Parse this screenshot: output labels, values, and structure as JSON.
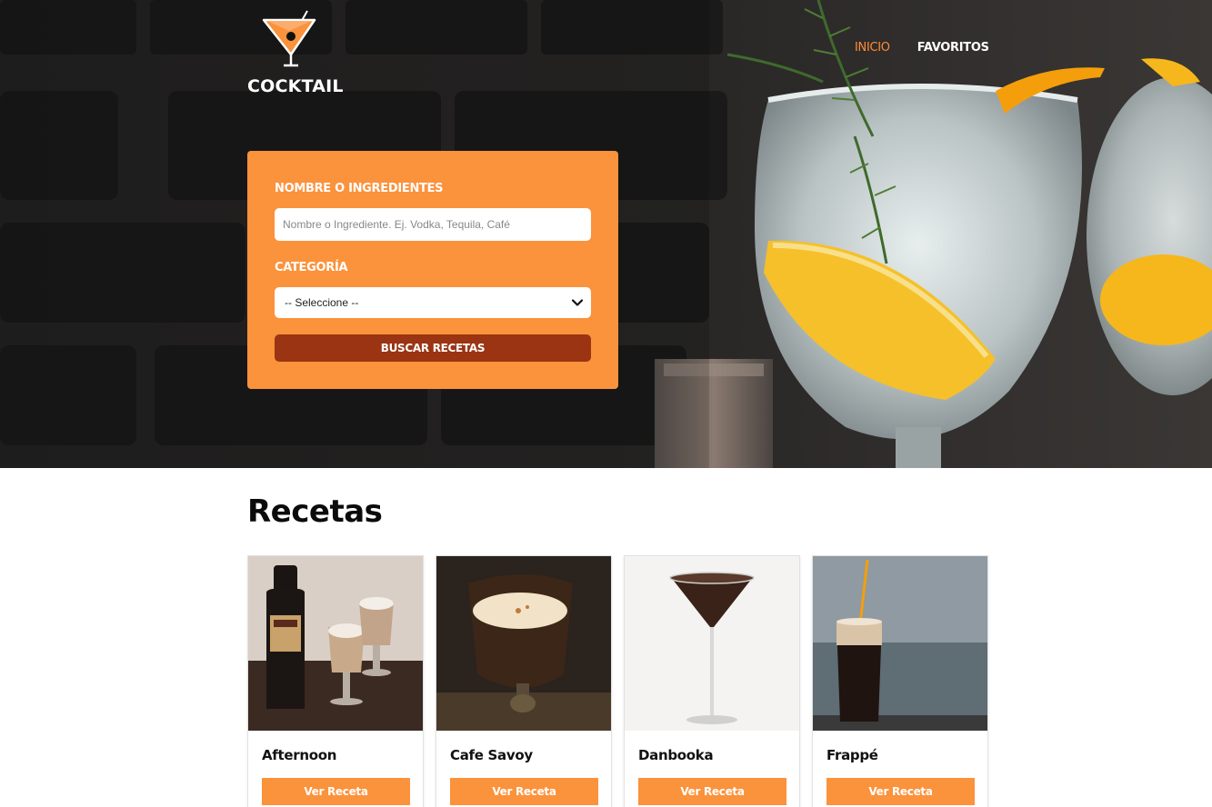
{
  "brand": {
    "name": "COCKTAIL",
    "logo_icon": "martini-glass-icon"
  },
  "nav": {
    "items": [
      {
        "label": "INICIO",
        "active": true
      },
      {
        "label": "FAVORITOS",
        "active": false
      }
    ]
  },
  "search": {
    "name_label": "NOMBRE O INGREDIENTES",
    "name_placeholder": "Nombre o Ingrediente. Ej. Vodka, Tequila, Café",
    "name_value": "",
    "category_label": "CATEGORÍA",
    "category_selected": "-- Seleccione --",
    "submit_label": "BUSCAR RECETAS"
  },
  "recipes": {
    "title": "Recetas",
    "items": [
      {
        "name": "Afternoon",
        "button": "Ver Receta"
      },
      {
        "name": "Cafe Savoy",
        "button": "Ver Receta"
      },
      {
        "name": "Danbooka",
        "button": "Ver Receta"
      },
      {
        "name": "Frappé",
        "button": "Ver Receta"
      }
    ]
  },
  "colors": {
    "accent": "#fb923c",
    "accent_dark": "#9a3412",
    "nav_active": "#ff8c35",
    "hero_bg": "#1d1c1c"
  }
}
